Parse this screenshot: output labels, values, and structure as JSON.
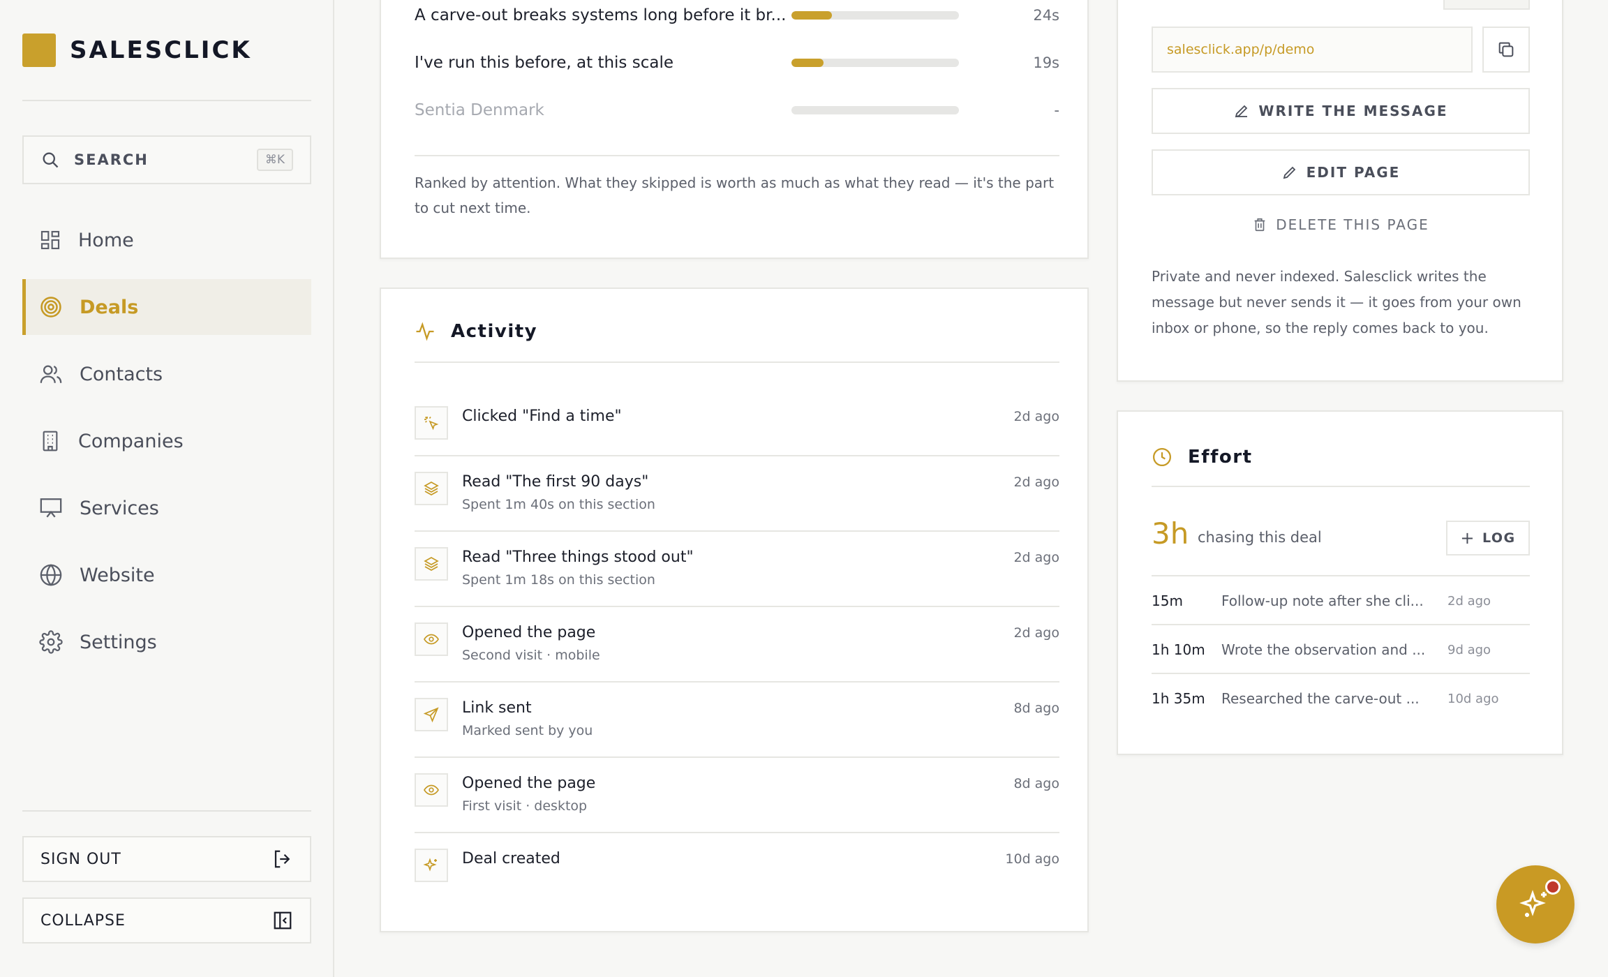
{
  "brand": {
    "name": "SALESCLICK",
    "accent": "#c9a02c"
  },
  "search": {
    "label": "SEARCH",
    "shortcut": "⌘K"
  },
  "nav": [
    {
      "label": "Home",
      "icon": "dashboard-icon"
    },
    {
      "label": "Deals",
      "icon": "target-icon",
      "active": true
    },
    {
      "label": "Contacts",
      "icon": "users-icon"
    },
    {
      "label": "Companies",
      "icon": "building-icon"
    },
    {
      "label": "Services",
      "icon": "presentation-icon"
    },
    {
      "label": "Website",
      "icon": "globe-icon"
    },
    {
      "label": "Settings",
      "icon": "gear-icon"
    }
  ],
  "sidebar_footer": {
    "sign_out": "SIGN OUT",
    "collapse": "COLLAPSE"
  },
  "attention": {
    "rows": [
      {
        "label": "A carve-out breaks systems long before it br...",
        "fill": 0.24,
        "time": "24s"
      },
      {
        "label": "I've run this before, at this scale",
        "fill": 0.19,
        "time": "19s"
      },
      {
        "label": "Sentia Denmark",
        "fill": 0,
        "time": "-",
        "muted": true
      }
    ],
    "note": "Ranked by attention. What they skipped is worth as much as what they read — it's the part to cut next time."
  },
  "activity": {
    "title": "Activity",
    "items": [
      {
        "icon": "click-icon",
        "title": "Clicked \"Find a time\"",
        "sub": "",
        "time": "2d ago"
      },
      {
        "icon": "layers-icon",
        "title": "Read \"The first 90 days\"",
        "sub": "Spent 1m 40s on this section",
        "time": "2d ago"
      },
      {
        "icon": "layers-icon",
        "title": "Read \"Three things stood out\"",
        "sub": "Spent 1m 18s on this section",
        "time": "2d ago"
      },
      {
        "icon": "eye-icon",
        "title": "Opened the page",
        "sub": "Second visit · mobile",
        "time": "2d ago"
      },
      {
        "icon": "send-icon",
        "title": "Link sent",
        "sub": "Marked sent by you",
        "time": "8d ago"
      },
      {
        "icon": "eye-icon",
        "title": "Opened the page",
        "sub": "First visit · desktop",
        "time": "8d ago"
      },
      {
        "icon": "sparkle-icon",
        "title": "Deal created",
        "sub": "",
        "time": "10d ago"
      }
    ]
  },
  "share": {
    "url": "salesclick.app/p/demo",
    "write_message": "WRITE THE MESSAGE",
    "edit_page": "EDIT PAGE",
    "delete_page": "DELETE THIS PAGE",
    "note": "Private and never indexed. Salesclick writes the message but never sends it — it goes from your own inbox or phone, so the reply comes back to you."
  },
  "effort": {
    "title": "Effort",
    "total": "3h",
    "caption": "chasing this deal",
    "log_label": "LOG",
    "entries": [
      {
        "duration": "15m",
        "description": "Follow-up note after she cli...",
        "when": "2d ago"
      },
      {
        "duration": "1h 10m",
        "description": "Wrote the observation and ...",
        "when": "9d ago"
      },
      {
        "duration": "1h 35m",
        "description": "Researched the carve-out ...",
        "when": "10d ago"
      }
    ]
  },
  "assistant": {
    "icon": "sparkle-icon",
    "notification_color": "#c0392b"
  }
}
